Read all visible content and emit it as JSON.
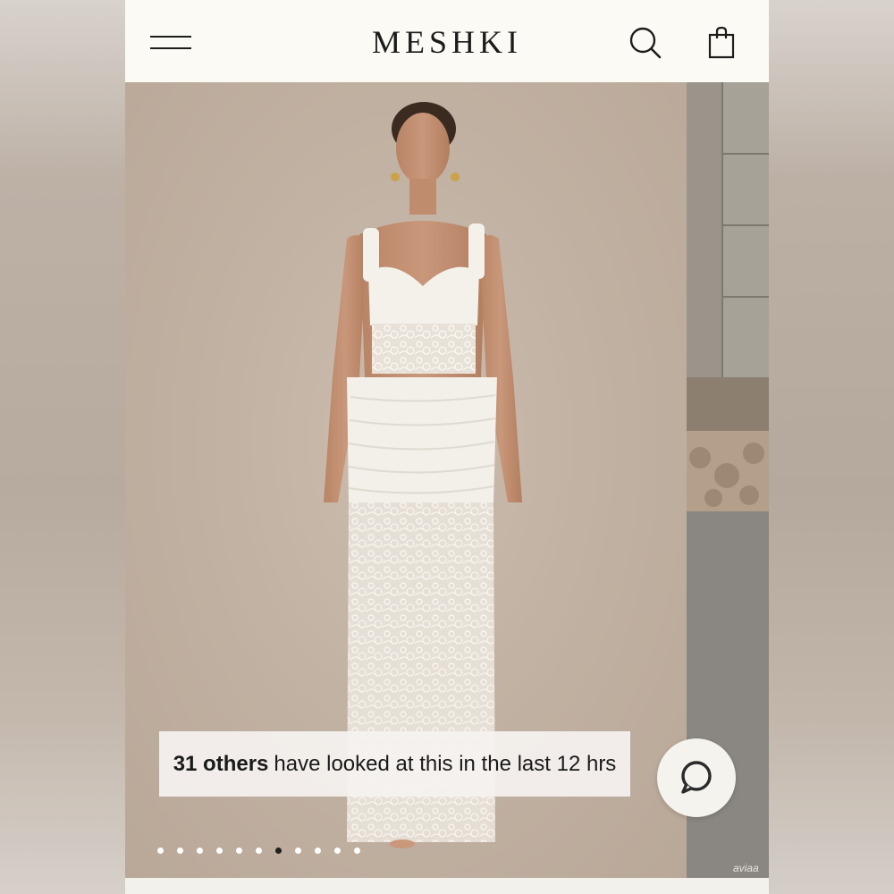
{
  "header": {
    "brand": "MESHKI",
    "icons": [
      "menu-icon",
      "search-icon",
      "bag-icon"
    ]
  },
  "product_gallery": {
    "social_proof": {
      "count_text": "31 others",
      "rest_text": "have looked at this in the last 12 hrs"
    },
    "carousel": {
      "total_slides": 11,
      "active_index": 6
    },
    "watermark": "aviaa"
  },
  "chat": {
    "icon": "chat-bubble-icon"
  },
  "colors": {
    "header_bg": "#fbfaf4",
    "brand_text": "#1b1b1b",
    "backdrop": "#c2b2a3",
    "garment": "#f4f1ea",
    "active_dot": "#1f1f1f"
  }
}
